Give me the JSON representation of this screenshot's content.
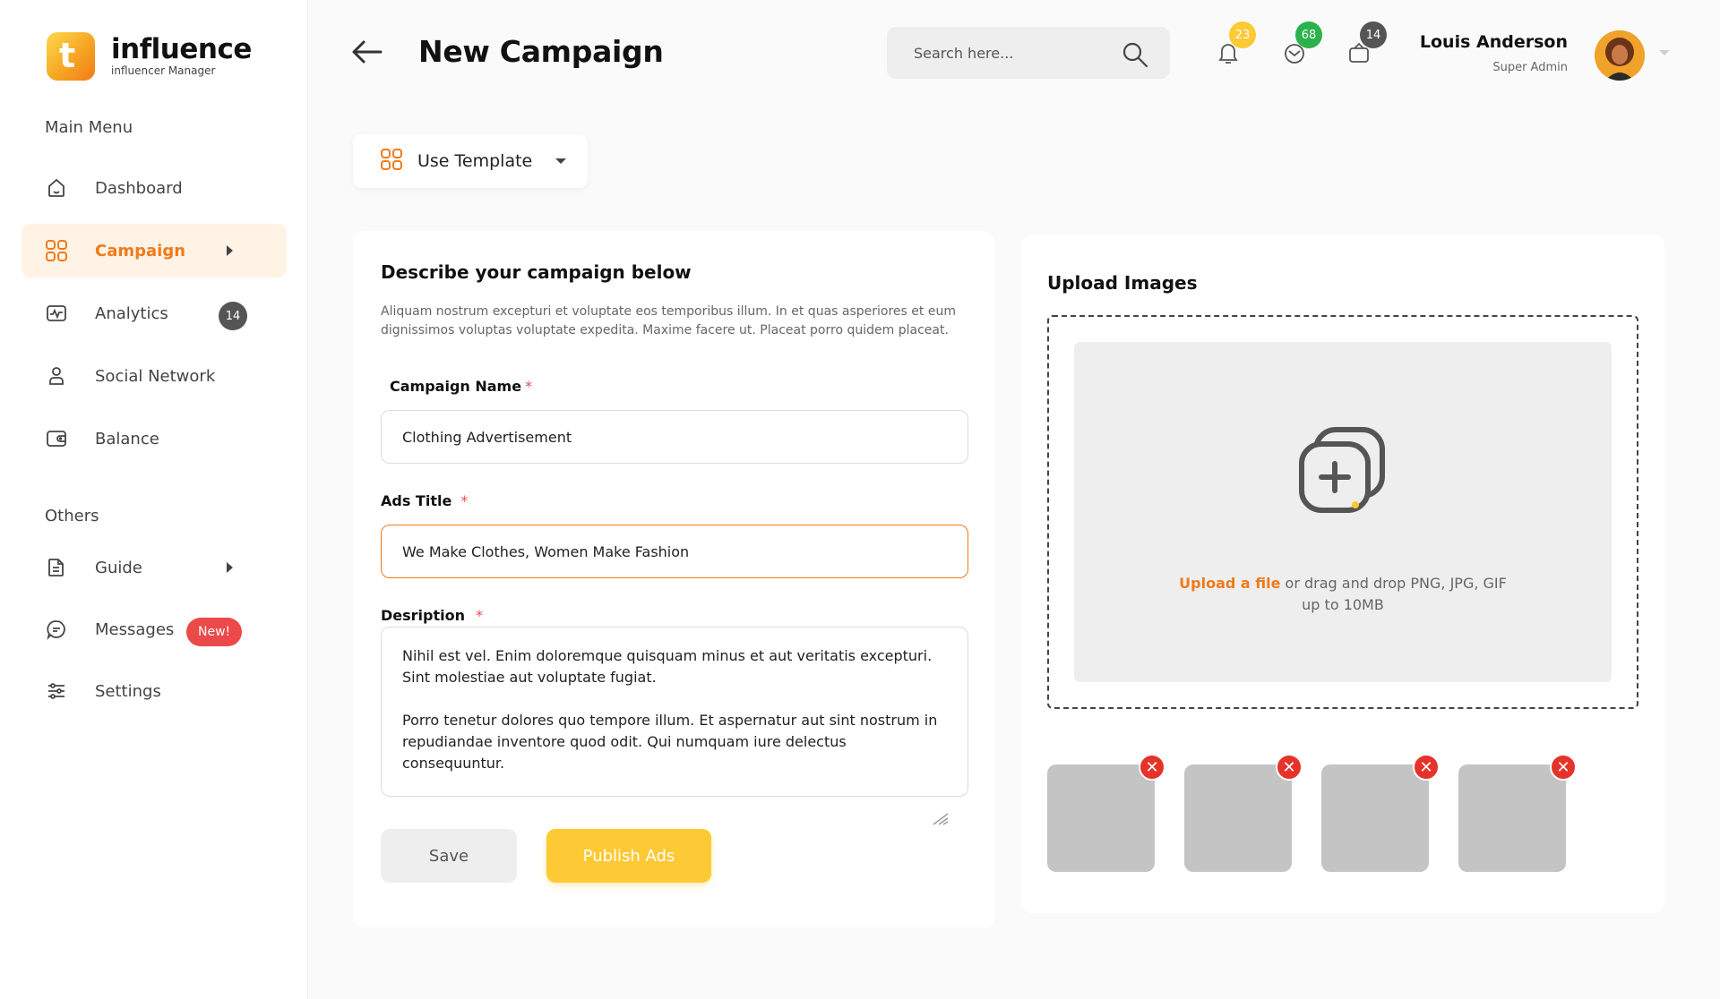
{
  "app": {
    "logo_letter": "t",
    "name": "influence",
    "tagline": "influencer Manager"
  },
  "sidebar": {
    "main_heading": "Main Menu",
    "main_items": [
      {
        "label": "Dashboard",
        "icon": "home-icon"
      },
      {
        "label": "Campaign",
        "icon": "grid-icon",
        "active": true
      },
      {
        "label": "Analytics",
        "icon": "activity-icon",
        "badge": "14"
      },
      {
        "label": "Social Network",
        "icon": "user-icon"
      },
      {
        "label": "Balance",
        "icon": "wallet-icon"
      }
    ],
    "others_heading": "Others",
    "other_items": [
      {
        "label": "Guide",
        "icon": "document-icon"
      },
      {
        "label": "Messages",
        "icon": "chat-icon",
        "badge": "New!"
      },
      {
        "label": "Settings",
        "icon": "sliders-icon"
      }
    ]
  },
  "header": {
    "title": "New Campaign",
    "search_placeholder": "Search here...",
    "notifications": {
      "count": "23",
      "color": "#fdc935"
    },
    "messages": {
      "count": "68",
      "color": "#2bb24c"
    },
    "cart": {
      "count": "14",
      "color": "#555555"
    },
    "user": {
      "name": "Louis Anderson",
      "role": "Super Admin"
    }
  },
  "template": {
    "label": "Use Template"
  },
  "form": {
    "title": "Describe your campaign below",
    "description": "Aliquam nostrum excepturi et voluptate eos temporibus illum. In et quas asperiores et eum dignissimos voluptas voluptate expedita. Maxime facere ut. Placeat porro quidem placeat.",
    "campaign_name_label": "Campaign Name",
    "campaign_name_value": "Clothing Advertisement",
    "ads_title_label": "Ads Title",
    "ads_title_value": "We Make Clothes, Women Make Fashion",
    "description_label": "Desription",
    "description_value": "Nihil est vel. Enim doloremque quisquam minus et aut veritatis excepturi. Sint molestiae aut voluptate fugiat.\n\nPorro tenetur dolores quo tempore illum. Et aspernatur aut sint nostrum in repudiandae inventore quod odit. Qui numquam iure delectus consequuntur.",
    "required_mark": "*",
    "save_label": "Save",
    "publish_label": "Publish Ads"
  },
  "upload": {
    "title": "Upload Images",
    "link_text": "Upload a file",
    "hint_line1": " or drag and drop PNG, JPG, GIF",
    "hint_line2": "up to 10MB",
    "thumbnails": 4,
    "remove_glyph": "✕"
  },
  "colors": {
    "accent": "#f07a1a",
    "publish": "#fdc935",
    "remove": "#e5332a"
  }
}
